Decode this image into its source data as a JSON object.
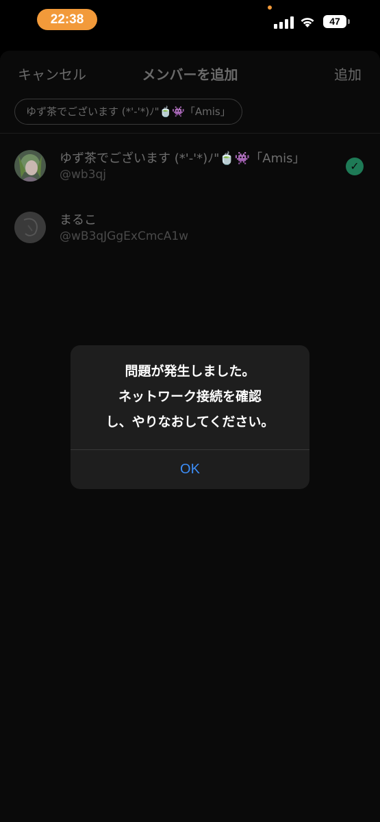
{
  "status_bar": {
    "time": "22:38",
    "battery": "47",
    "time_pill_color": "#f29a3a"
  },
  "nav": {
    "cancel": "キャンセル",
    "title": "メンバーを追加",
    "add": "追加"
  },
  "selected_chip": "ゆず茶でございます (*'-'*)ﾉ\"🍵👾「Amis」",
  "members": [
    {
      "name": "ゆず茶でございます (*'-'*)ﾉ\"🍵👾「Amis」",
      "handle": "@wb3qj",
      "selected": true
    },
    {
      "name": "まるこ",
      "handle": "@wB3qJGgExCmcA1w",
      "selected": false
    }
  ],
  "alert": {
    "line1": "問題が発生しました。",
    "line2": "ネットワーク接続を確認",
    "line3": "し、やりなおしてください。",
    "ok": "OK"
  },
  "colors": {
    "background": "#000000",
    "check_green": "#1e7a56",
    "alert_button": "#3c8df7"
  },
  "icons": [
    "signal-icon",
    "wifi-icon",
    "battery-icon",
    "checkmark-icon"
  ]
}
